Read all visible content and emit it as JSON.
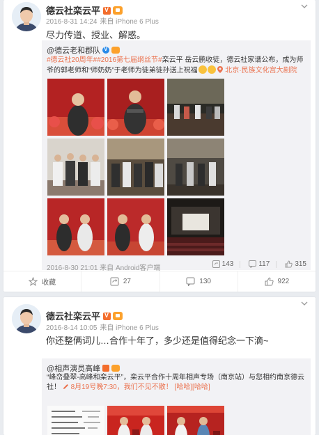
{
  "posts": [
    {
      "author": "德云社栾云平",
      "timestamp": "2016-8-31 14:24",
      "source": "来自 iPhone 6 Plus",
      "text": "尽力传道、授业、解惑。",
      "repost": {
        "author": "@德云老和郡队",
        "text_hashtags": "#德云社20周年##2016第七届纲丝节#",
        "text_body": "栾云平 岳云鹏收徒，德云社家谱公布，成为师爷的郭老师和“师奶奶”于老师为徒弟徒孙送上祝福",
        "location": "北京·民族文化宫大剧院",
        "meta": "2016-8-30 21:01 来自 Android客户端",
        "stats": {
          "forward": "143",
          "comment": "117",
          "like": "315"
        }
      },
      "actions": {
        "favorite": "收藏",
        "forward": "27",
        "comment": "130",
        "like": "922"
      }
    },
    {
      "author": "德云社栾云平",
      "timestamp": "2016-8-14 10:05",
      "source": "来自 iPhone 6 Plus",
      "text": "你还整俩词儿…合作十年了，多少还是值得纪念一下滴~",
      "repost": {
        "author": "@相声演员高峰",
        "text_body": "“峰峦叠翠-高峰和栾云平”，栾云平合作十周年相声专场（南京站）与您相约南京德云社！",
        "text_date": "8月19号晚7:30，我们不见不散！",
        "text_emoji": "[哈哈][哈哈]"
      }
    }
  ],
  "colors": {
    "accent": "#eb7350",
    "page_bg": "#e9ecf0",
    "repost_bg": "#f2f2f5"
  }
}
